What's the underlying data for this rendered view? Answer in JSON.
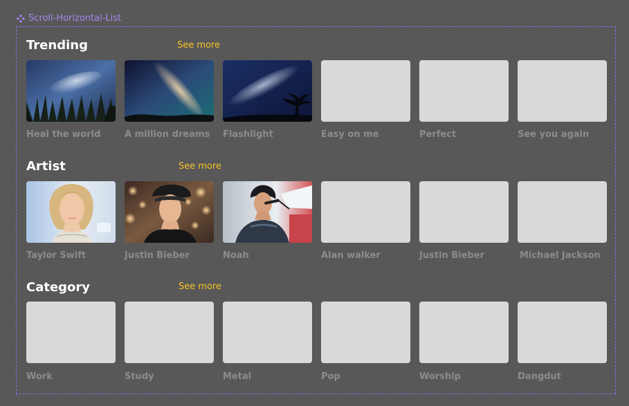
{
  "component": {
    "label": "Scroll-Horizontal-List",
    "icon": "component-diamond-icon",
    "accent_color": "#8e6bf0"
  },
  "sections": [
    {
      "title": "Trending",
      "see_more": "See more",
      "items": [
        {
          "label": "Heal the  world",
          "image": "milky-way-forest"
        },
        {
          "label": "A million dreams",
          "image": "milky-way-glow"
        },
        {
          "label": "Flashlight",
          "image": "milky-way-tree"
        },
        {
          "label": "Easy on me",
          "image": null
        },
        {
          "label": "Perfect",
          "image": null
        },
        {
          "label": "See you again",
          "image": null
        }
      ]
    },
    {
      "title": "Artist",
      "see_more": "See more",
      "items": [
        {
          "label": "Taylor Swift",
          "image": "portrait-blonde"
        },
        {
          "label": "Justin Bieber",
          "image": "portrait-bokeh"
        },
        {
          "label": "Noah",
          "image": "portrait-singer"
        },
        {
          "label": "Alan walker",
          "image": null
        },
        {
          "label": "Justin Bieber",
          "image": null
        },
        {
          "label": "Michael Jackson",
          "image": null
        }
      ]
    },
    {
      "title": "Category",
      "see_more": "See more",
      "items": [
        {
          "label": "Work",
          "image": null
        },
        {
          "label": "Study",
          "image": null
        },
        {
          "label": "Metal",
          "image": null
        },
        {
          "label": "Pop",
          "image": null
        },
        {
          "label": "Worship",
          "image": null
        },
        {
          "label": "Dangdut",
          "image": null
        }
      ]
    }
  ],
  "colors": {
    "background": "#585858",
    "placeholder": "#d9d9d9",
    "section_title": "#ffffff",
    "see_more": "#f4c327",
    "item_label": "#8c8c8c",
    "component_label": "#a788f0"
  }
}
